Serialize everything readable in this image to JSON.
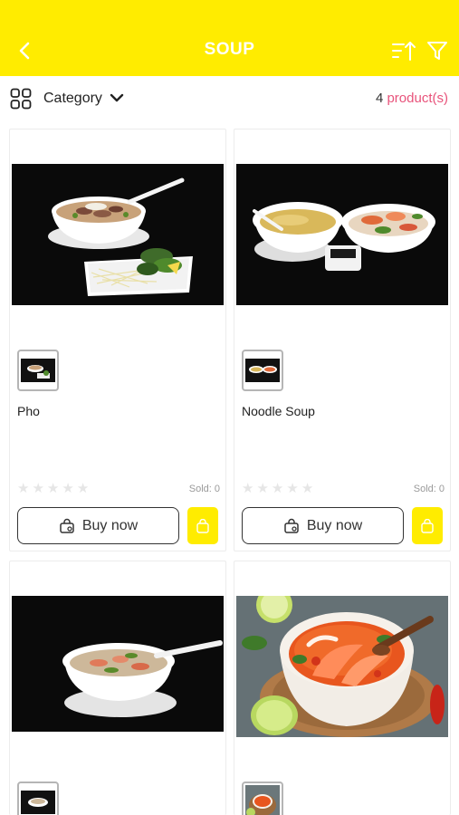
{
  "header": {
    "title": "SOUP",
    "back_icon": "chevron-left-icon",
    "sort_icon": "sort-ascending-icon",
    "filter_icon": "filter-icon",
    "bg_color": "#FFEC00"
  },
  "toolbar": {
    "category_label": "Category",
    "product_count": "4",
    "product_unit": "product(s)",
    "accent_color": "#e8537b"
  },
  "products": [
    {
      "name": "Pho",
      "sold": "Sold: 0",
      "buy_label": "Buy now",
      "rating": 0
    },
    {
      "name": "Noodle Soup",
      "sold": "Sold: 0",
      "buy_label": "Buy now",
      "rating": 0
    },
    {
      "name": "",
      "sold": "",
      "buy_label": "",
      "rating": 0
    },
    {
      "name": "",
      "sold": "",
      "buy_label": "",
      "rating": 0
    }
  ]
}
